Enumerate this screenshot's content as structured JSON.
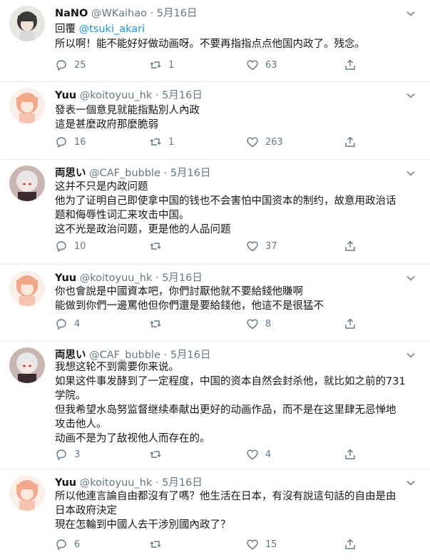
{
  "tweets": [
    {
      "name": "NaNO",
      "handle": "@WKaihao",
      "date": "5月16日",
      "reply_prefix": "回覆 ",
      "reply_mention": "@tsuki_akari",
      "lines": [
        "所以啊！能不能好好做动画呀。不要再指指点点他国内政了。残念。"
      ],
      "replies": "25",
      "retweets": "1",
      "likes": "63",
      "avatar": "dark-haired-anime-girl"
    },
    {
      "name": "Yuu",
      "handle": "@koitoyuu_hk",
      "date": "5月16日",
      "lines": [
        "發表一個意見就能指點別人內政",
        "這是甚麼政府那麼脆弱"
      ],
      "replies": "16",
      "retweets": "1",
      "likes": "263",
      "avatar": "pink-haired-anime-girl"
    },
    {
      "name": "両思い",
      "handle": "@CAF_bubble",
      "date": "5月16日",
      "lines": [
        "这并不只是内政问题",
        "他为了证明自己即使拿中国的钱也不会害怕中国资本的制约，故意用政治话",
        "题和侮辱性词汇来攻击中国。",
        "这不光是政治问题，更是他的人品问题"
      ],
      "replies": "10",
      "retweets": "",
      "likes": "37",
      "avatar": "silver-haired-anime-girl"
    },
    {
      "name": "Yuu",
      "handle": "@koitoyuu_hk",
      "date": "5月16日",
      "lines": [
        "你也會說是中國資本吧，你們討厭他就不要給錢他賺啊",
        "能做到你們一邊罵他但你們還是要給錢他，他這不是很猛不"
      ],
      "replies": "4",
      "retweets": "",
      "likes": "8",
      "avatar": "pink-haired-anime-girl"
    },
    {
      "name": "両思い",
      "handle": "@CAF_bubble",
      "date": "5月16日",
      "lines": [
        "我想这轮不到需要你来说。",
        "如果这件事发酵到了一定程度，中国的资本自然会封杀他，就比如之前的731",
        "学院。",
        "但我希望水岛努监督继续奉献出更好的动画作品，而不是在这里肆无忌惮地",
        "攻击他人。",
        "动画不是为了敌视他人而存在的。"
      ],
      "replies": "3",
      "retweets": "",
      "likes": "4",
      "avatar": "silver-haired-anime-girl"
    },
    {
      "name": "Yuu",
      "handle": "@koitoyuu_hk",
      "date": "5月16日",
      "lines": [
        "所以他連言論自由都沒有了嗎？他生活在日本，有沒有說這句話的自由是由",
        "日本政府決定",
        "現在怎輪到中國人去干涉別國內政了？"
      ],
      "replies": "6",
      "retweets": "",
      "likes": "15",
      "avatar": "pink-haired-anime-girl"
    }
  ],
  "dot": "·",
  "colors": {
    "text": "#14171a",
    "secondary": "#657786",
    "link": "#1b95e0",
    "separator": "#e6ecf0"
  }
}
